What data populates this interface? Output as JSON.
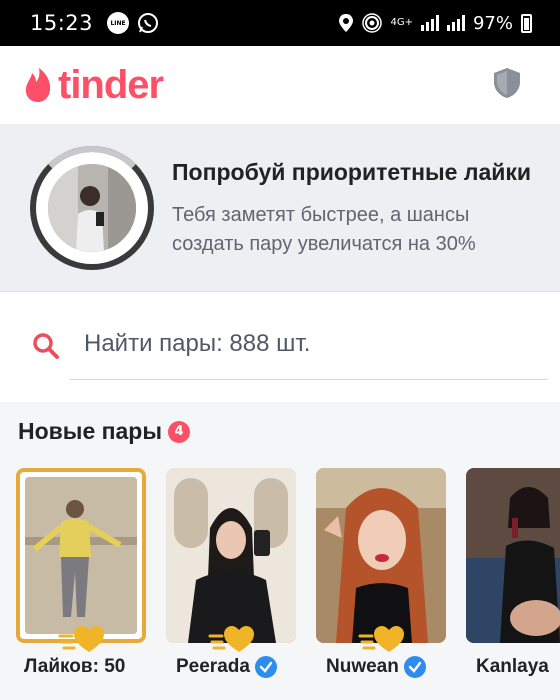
{
  "status_bar": {
    "time": "15:23",
    "badges": [
      "LINE"
    ],
    "network": "4G+",
    "battery": "97%"
  },
  "header": {
    "logo_text": "tinder",
    "brand_color": "#fd5068"
  },
  "promo": {
    "title": "Попробуй приоритетные лайки",
    "subtitle": "Тебя заметят быстрее, а шансы создать пару увеличатся на 30%"
  },
  "search": {
    "label": "Найти пары: 888 шт."
  },
  "matches": {
    "title": "Новые пары",
    "count": "4",
    "cards": [
      {
        "label": "Лайков: 50",
        "verified": false,
        "accent": "#e7a93b"
      },
      {
        "label": "Peerada",
        "verified": true
      },
      {
        "label": "Nuwean",
        "verified": true
      },
      {
        "label": "Kanlaya",
        "verified": false
      }
    ]
  },
  "icons": {
    "logo": "flame-icon",
    "safety": "shield-icon",
    "search": "search-icon",
    "verified": "verified-check-icon",
    "gold_like": "gold-heart-icon"
  }
}
